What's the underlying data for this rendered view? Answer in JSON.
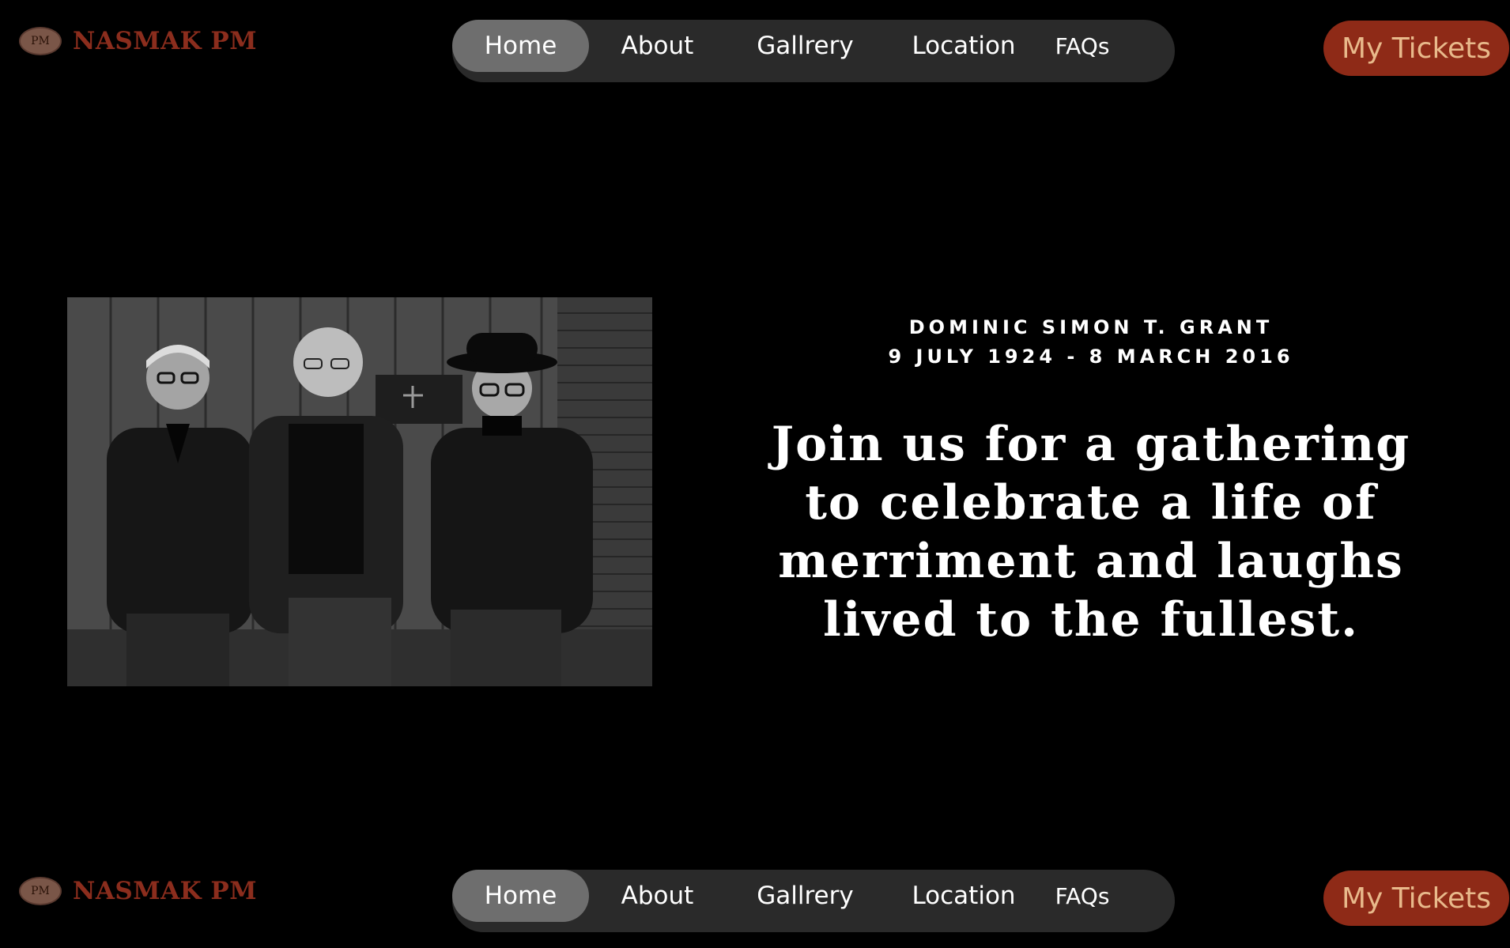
{
  "brand": {
    "logo_mark": "PM",
    "name": "NASMAK PM",
    "color": "#8b2d1d"
  },
  "nav": {
    "items": [
      {
        "label": "Home",
        "active": true
      },
      {
        "label": "About",
        "active": false
      },
      {
        "label": "Gallrery",
        "active": false
      },
      {
        "label": "Location",
        "active": false
      },
      {
        "label": "FAQs",
        "active": false
      }
    ]
  },
  "cta": {
    "tickets_label": "My Tickets",
    "color": "#8e2a17"
  },
  "hero": {
    "name": "DOMINIC SIMON T. GRANT",
    "dates": "9 JULY 1924 - 8 MARCH 2016",
    "headline_lines": [
      "Join us for a gathering",
      "to celebrate a life of",
      "merriment and laughs",
      "lived to the fullest."
    ]
  }
}
